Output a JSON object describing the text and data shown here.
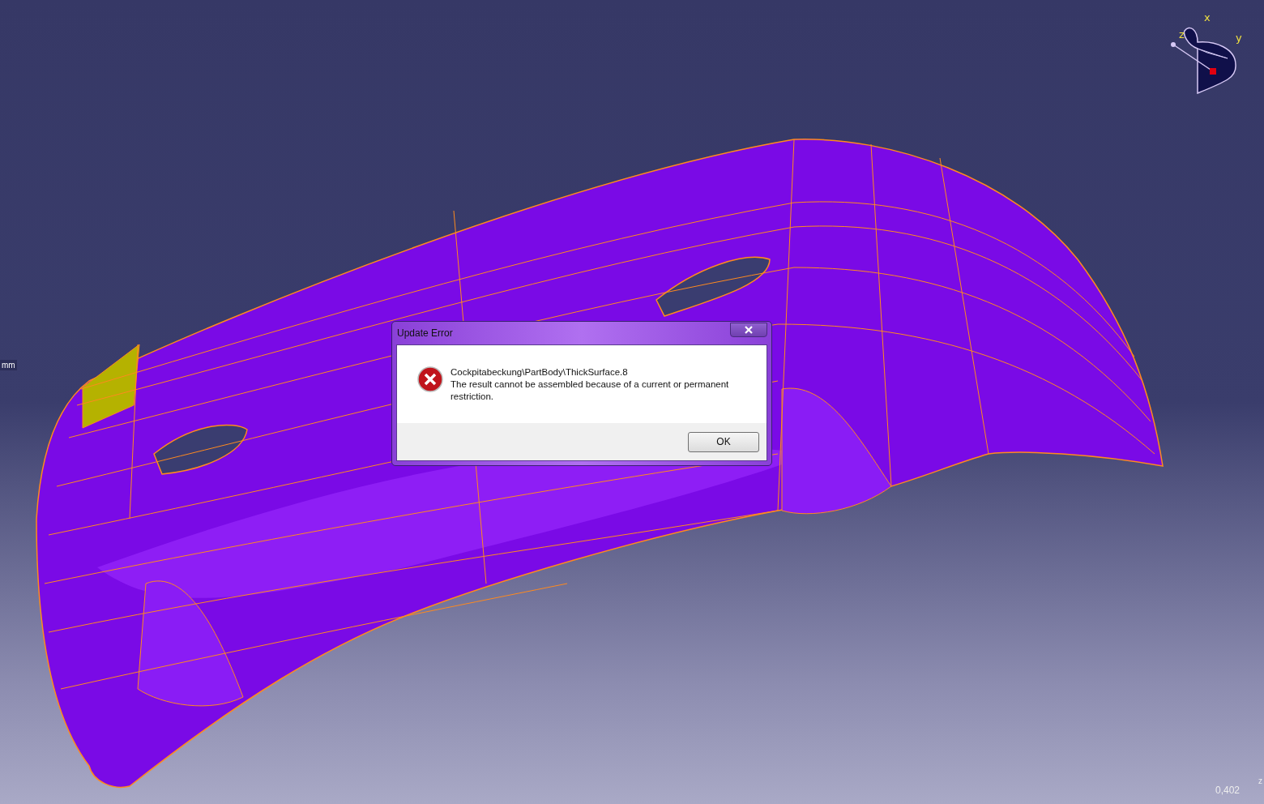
{
  "viewport": {
    "unit": "mm",
    "scale": "0,402",
    "edge_label": "z"
  },
  "compass": {
    "axes": [
      {
        "label": "x"
      },
      {
        "label": "y"
      },
      {
        "label": "z"
      }
    ]
  },
  "dialog": {
    "title": "Update Error",
    "path": "Cockpitabeckung\\PartBody\\ThickSurface.8",
    "message": "The result cannot be assembled because of a current or permanent restriction.",
    "buttons": [
      "OK"
    ]
  }
}
